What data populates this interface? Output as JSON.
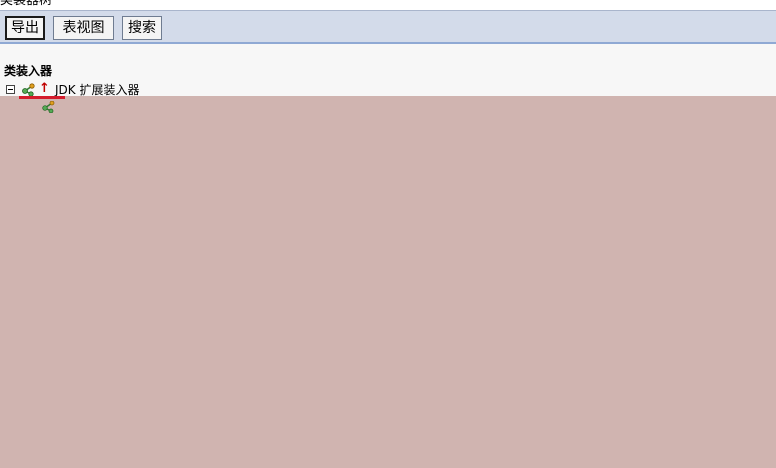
{
  "window": {
    "title": "类装器树"
  },
  "toolbar": {
    "buttons": [
      {
        "label": "导出"
      },
      {
        "label": "表视图"
      },
      {
        "label": "搜索"
      }
    ]
  },
  "content": {
    "heading": "类装入器",
    "tree": [
      {
        "label": "JDK 扩展装入器",
        "icon": "classloader-icon",
        "badge": "up-arrow-icon",
        "expanded": true
      }
    ]
  },
  "colors": {
    "toolbar_bg": "#d3dbea",
    "overlay": "#d0b4b0",
    "highlight_line": "#d41b2c",
    "arrow": "#c00000"
  }
}
